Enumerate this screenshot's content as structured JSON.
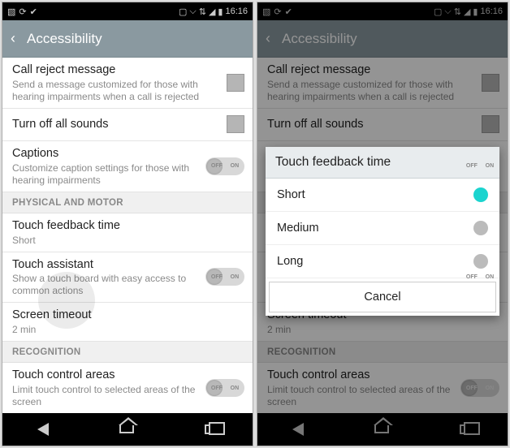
{
  "status": {
    "time": "16:16"
  },
  "appbar": {
    "title": "Accessibility"
  },
  "rows": {
    "callReject": {
      "title": "Call reject message",
      "sub": "Send a message customized for those with hearing impairments when a call is rejected"
    },
    "turnOff": {
      "title": "Turn off all sounds"
    },
    "captions": {
      "title": "Captions",
      "sub": "Customize caption settings for those with hearing impairments"
    },
    "touchFeedback": {
      "title": "Touch feedback time",
      "sub": "Short"
    },
    "touchAssist": {
      "title": "Touch assistant",
      "sub": "Show a touch board with easy access to common actions"
    },
    "screenTimeout": {
      "title": "Screen timeout",
      "sub": "2 min"
    },
    "touchControl": {
      "title": "Touch control areas",
      "sub": "Limit touch control to selected areas of the screen"
    }
  },
  "sections": {
    "physical": "PHYSICAL AND MOTOR",
    "recognition": "RECOGNITION"
  },
  "toggle": {
    "off": "OFF",
    "on": "ON"
  },
  "dialog": {
    "title": "Touch feedback time",
    "options": {
      "short": "Short",
      "medium": "Medium",
      "long": "Long"
    },
    "cancel": "Cancel"
  }
}
